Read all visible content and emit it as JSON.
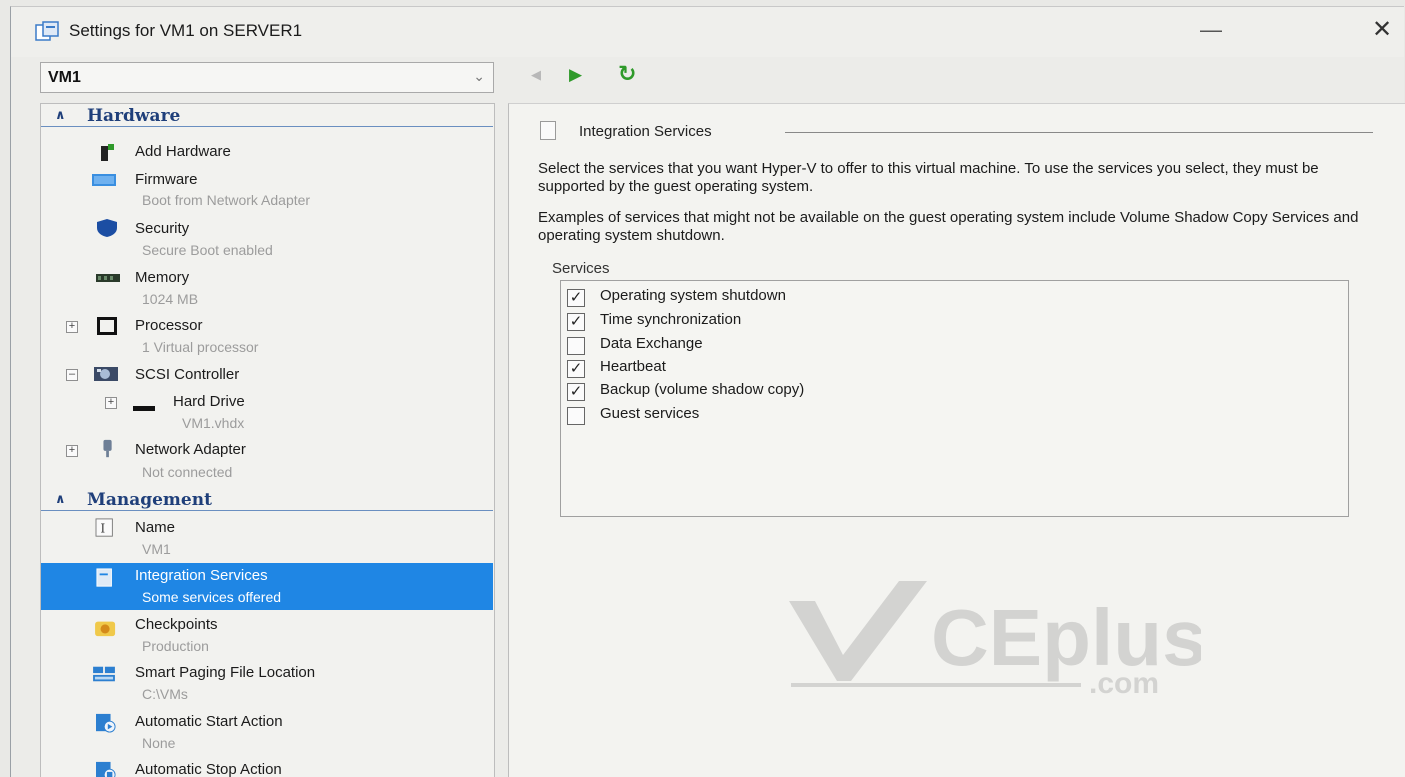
{
  "window": {
    "title": "Settings for VM1 on SERVER1",
    "minimize_glyph": "—",
    "close_glyph": "✕"
  },
  "vm_select": {
    "value": "VM1"
  },
  "toolbar": {
    "back_icon": "back-arrow-icon",
    "start_icon": "start-icon",
    "refresh_icon": "refresh-icon"
  },
  "sidebar": {
    "hardware": {
      "label": "Hardware",
      "items": [
        {
          "label": "Add Hardware",
          "sub": ""
        },
        {
          "label": "Firmware",
          "sub": "Boot from Network Adapter"
        },
        {
          "label": "Security",
          "sub": "Secure Boot enabled"
        },
        {
          "label": "Memory",
          "sub": "1024 MB"
        },
        {
          "label": "Processor",
          "sub": "1 Virtual processor"
        },
        {
          "label": "SCSI Controller",
          "sub": ""
        },
        {
          "label": "Hard Drive",
          "sub": "VM1.vhdx"
        },
        {
          "label": "Network Adapter",
          "sub": "Not connected"
        }
      ]
    },
    "management": {
      "label": "Management",
      "items": [
        {
          "label": "Name",
          "sub": "VM1"
        },
        {
          "label": "Integration Services",
          "sub": "Some services offered"
        },
        {
          "label": "Checkpoints",
          "sub": "Production"
        },
        {
          "label": "Smart Paging File Location",
          "sub": "C:\\VMs"
        },
        {
          "label": "Automatic Start Action",
          "sub": "None"
        },
        {
          "label": "Automatic Stop Action",
          "sub": ""
        }
      ]
    }
  },
  "main": {
    "group_title": "Integration Services",
    "description_1": "Select the services that you want Hyper-V to offer to this virtual machine. To use the services you select, they must be supported by the guest operating system.",
    "description_2": "Examples of services that might not be available on the guest operating system include Volume Shadow Copy Services and operating system shutdown.",
    "services_label": "Services",
    "services": [
      {
        "label": "Operating system shutdown",
        "checked": true
      },
      {
        "label": "Time synchronization",
        "checked": true
      },
      {
        "label": "Data Exchange",
        "checked": false
      },
      {
        "label": "Heartbeat",
        "checked": true
      },
      {
        "label": "Backup (volume shadow copy)",
        "checked": true
      },
      {
        "label": "Guest services",
        "checked": false
      }
    ]
  },
  "watermark": {
    "brand": "CEplus",
    "suffix": ".com"
  },
  "colors": {
    "selection": "#1f86e4",
    "section_header": "#1f3f7a",
    "green": "#2f9a2a"
  }
}
